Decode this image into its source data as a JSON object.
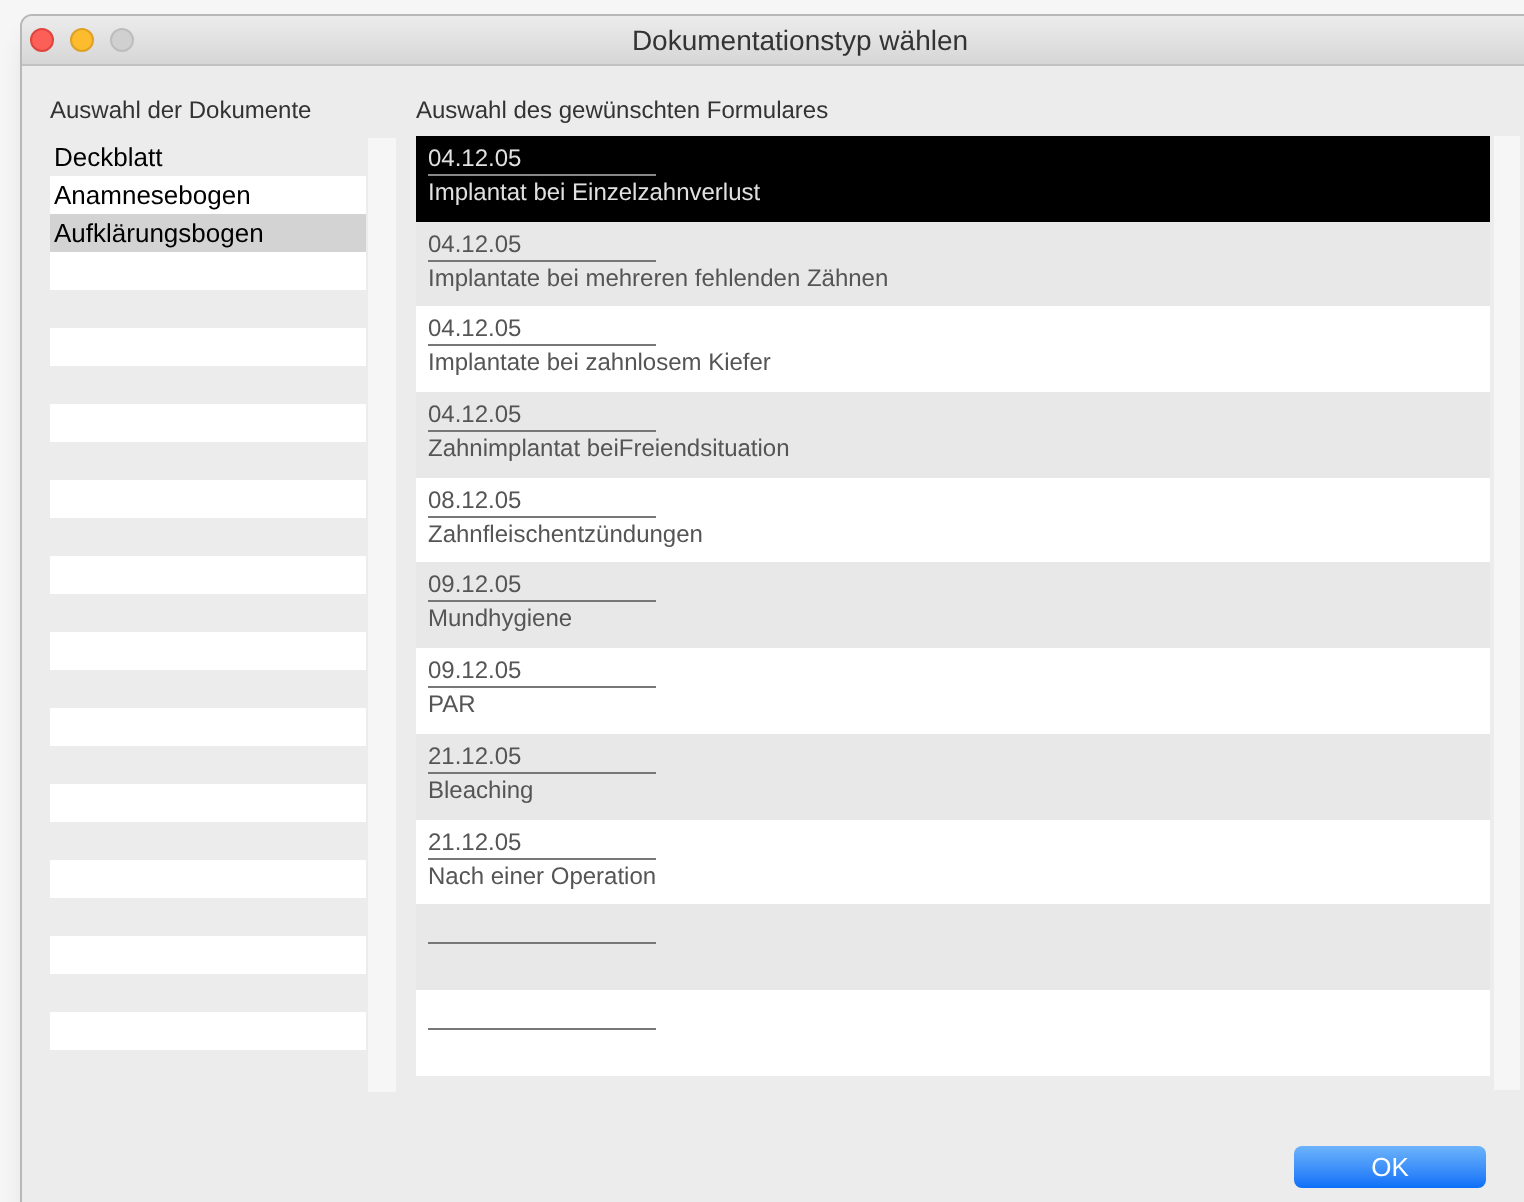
{
  "window": {
    "title": "Dokumentationstyp wählen"
  },
  "documents": {
    "heading": "Auswahl der Dokumente",
    "items": [
      {
        "label": "Deckblatt",
        "selected": false
      },
      {
        "label": "Anamnesebogen",
        "selected": false
      },
      {
        "label": "Aufklärungsbogen",
        "selected": true
      }
    ]
  },
  "forms": {
    "heading": "Auswahl des gewünschten Formulares",
    "items": [
      {
        "kind": "form",
        "date": "04.12.05",
        "title": "Implantat bei Einzelzahnverlust",
        "selected": true
      },
      {
        "kind": "form",
        "date": "04.12.05",
        "title": "Implantate bei mehreren fehlenden Zähnen",
        "selected": false
      },
      {
        "kind": "form",
        "date": "04.12.05",
        "title": "Implantate bei zahnlosem Kiefer",
        "selected": false
      },
      {
        "kind": "form",
        "date": "04.12.05",
        "title": "Zahnimplantat beiFreiendsituation",
        "selected": false
      },
      {
        "kind": "form",
        "date": "08.12.05",
        "title": "Zahnfleischentzündungen",
        "selected": false
      },
      {
        "kind": "form",
        "date": "09.12.05",
        "title": "Mundhygiene",
        "selected": false
      },
      {
        "kind": "form",
        "date": "09.12.05",
        "title": "PAR",
        "selected": false
      },
      {
        "kind": "form",
        "date": "21.12.05",
        "title": "Bleaching",
        "selected": false
      },
      {
        "kind": "form",
        "date": "21.12.05",
        "title": "Nach einer Operation",
        "selected": false
      },
      {
        "kind": "blank",
        "selected": false
      },
      {
        "kind": "blank",
        "selected": false
      }
    ]
  },
  "buttons": {
    "ok": "OK"
  }
}
